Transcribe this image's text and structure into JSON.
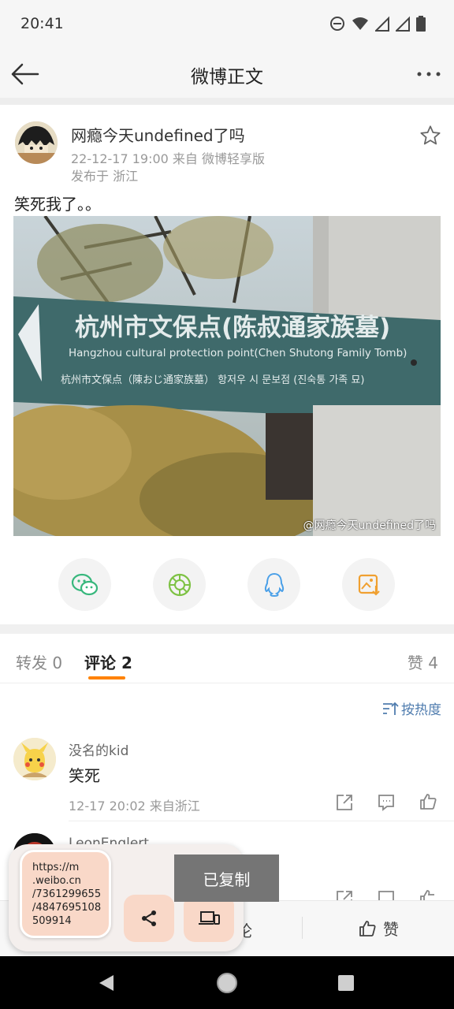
{
  "status_bar": {
    "time": "20:41",
    "icons": [
      "do-not-disturb-icon",
      "wifi-icon",
      "signal-icon",
      "signal-icon",
      "battery-icon"
    ]
  },
  "app_bar": {
    "title": "微博正文",
    "back_icon": "arrow-left-icon",
    "more_icon": "more-dots-icon"
  },
  "post": {
    "author": "网瘾今天undefined了吗",
    "meta": "22-12-17 19:00   来自 微博轻享版",
    "location": "发布于 浙江",
    "text": "笑死我了。。",
    "photo": {
      "watermark": "@网瘾今天undefined了吗",
      "sign_line1": "杭州市文保点(陈叔通家族墓)",
      "sign_line2": "Hangzhou cultural protection point(Chen Shutong Family Tomb)",
      "sign_line3": "杭州市文保点（陳おじ通家族墓）  항저우 시 문보점 (진숙통 가족 묘)"
    }
  },
  "share": [
    "wechat-icon",
    "moments-icon",
    "qq-icon",
    "save-image-icon"
  ],
  "tabs": {
    "repost": "转发 0",
    "comments": "评论 2",
    "likes": "赞 4"
  },
  "sort_label": "按热度",
  "comments": [
    {
      "name": "没名的kid",
      "text": "笑死",
      "meta": "12-17 20:02  来自浙江"
    },
    {
      "name": "LeonEnglert",
      "text": ""
    }
  ],
  "bottom_bar": {
    "comment_label": "论",
    "like_label": "赞"
  },
  "clipboard": {
    "url_lines": [
      "https://m",
      ".weibo.cn",
      "/7361299655",
      "/4847695108",
      "509914"
    ]
  },
  "toast": "已复制",
  "colors": {
    "accent": "#ff8200",
    "link": "#507daf",
    "clip_bg": "#f9d8c8"
  }
}
